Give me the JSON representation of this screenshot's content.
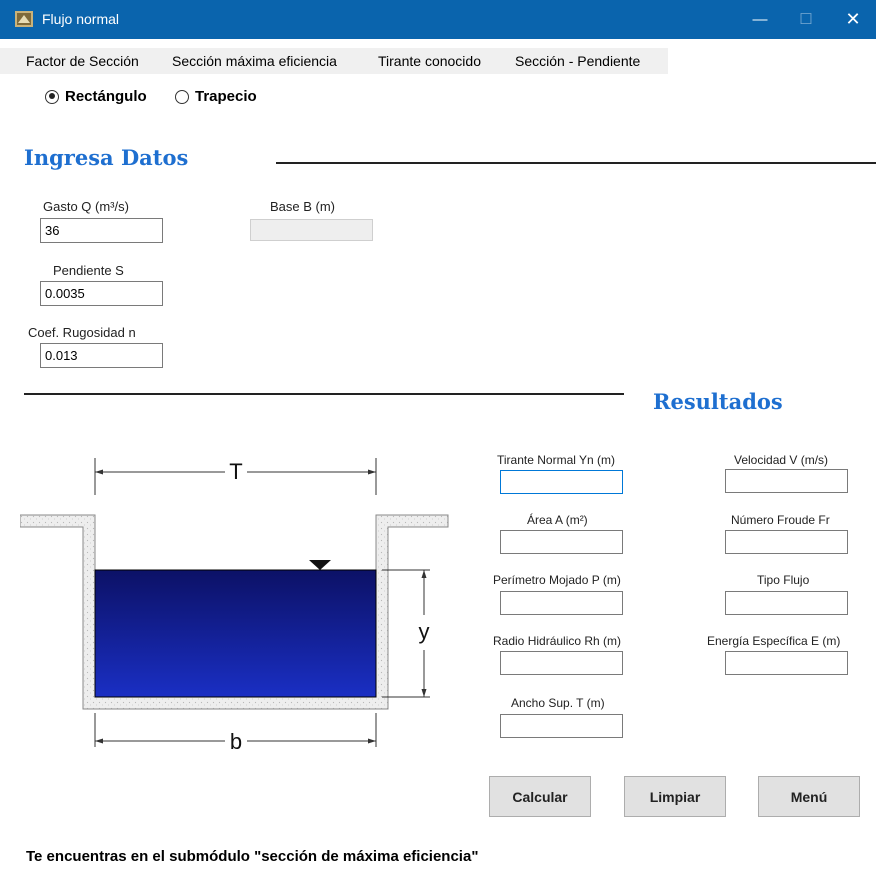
{
  "window": {
    "title": "Flujo normal",
    "minimize": "—",
    "maximize": "☐",
    "close": "✕"
  },
  "menu": [
    "Factor de Sección",
    "Sección máxima eficiencia",
    "Tirante conocido",
    "Sección - Pendiente"
  ],
  "shape": {
    "options": [
      "Rectángulo",
      "Trapecio"
    ],
    "selected": "Rectángulo"
  },
  "inputs_section": {
    "title": "Ingresa Datos",
    "gasto_label": "Gasto Q (m³/s)",
    "gasto_value": "36",
    "base_label": "Base B (m)",
    "base_value": "",
    "pendiente_label": "Pendiente S",
    "pendiente_value": "0.0035",
    "rugosidad_label": "Coef. Rugosidad n",
    "rugosidad_value": "0.013"
  },
  "results_section": {
    "title": "Resultados",
    "tirante_label": "Tirante Normal Yn (m)",
    "tirante_value": "",
    "area_label": "Área A (m²)",
    "area_value": "",
    "perimetro_label": "Perímetro Mojado P (m)",
    "perimetro_value": "",
    "radio_label": "Radio Hidráulico Rh (m)",
    "radio_value": "",
    "ancho_label": "Ancho Sup. T (m)",
    "ancho_value": "",
    "velocidad_label": "Velocidad V (m/s)",
    "velocidad_value": "",
    "froude_label": "Número Froude Fr",
    "froude_value": "",
    "tipo_label": "Tipo Flujo",
    "tipo_value": "",
    "energia_label": "Energía Específica E (m)",
    "energia_value": ""
  },
  "diagram": {
    "top_width_label": "T",
    "depth_label": "y",
    "base_label": "b"
  },
  "buttons": {
    "calcular": "Calcular",
    "limpiar": "Limpiar",
    "menu": "Menú"
  },
  "status": "Te encuentras en el submódulo \"sección de máxima eficiencia\"",
  "colors": {
    "titlebar": "#0a64ad",
    "section_title": "#1e6fd0",
    "water_dark": "#0c1166",
    "water_light": "#1a2fc4"
  }
}
